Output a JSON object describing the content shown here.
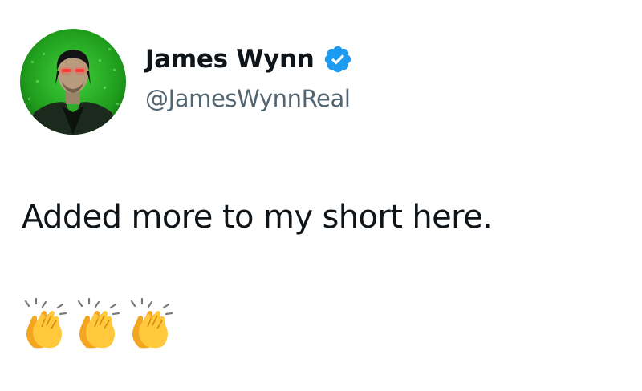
{
  "author": {
    "display_name": "James Wynn",
    "handle": "@JamesWynnReal",
    "verified": true,
    "avatar_icon": "avatar-photo",
    "verified_icon": "verified-badge-icon",
    "verified_color": "#1d9bf0"
  },
  "tweet": {
    "text": "Added more to my short here.",
    "emojis": [
      "clapping-hands-icon",
      "clapping-hands-icon",
      "clapping-hands-icon"
    ]
  }
}
